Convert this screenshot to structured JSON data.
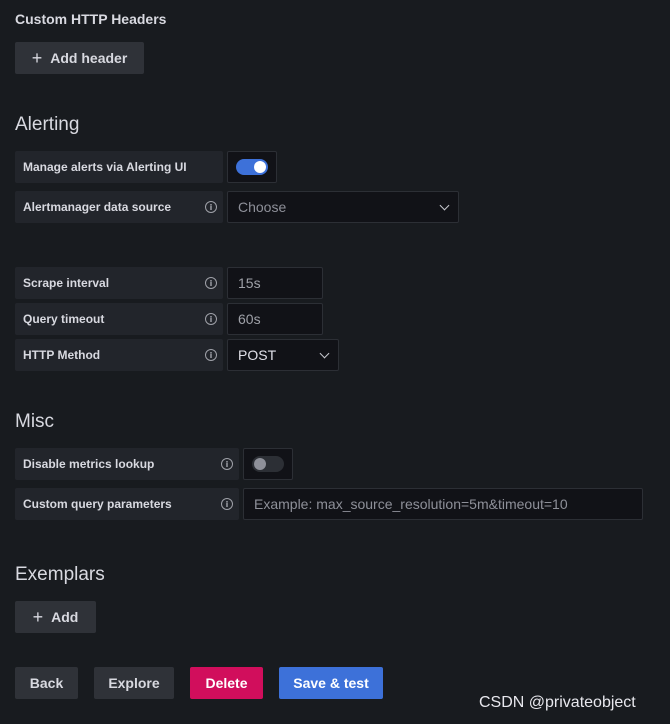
{
  "headers_section": {
    "title": "Custom HTTP Headers",
    "add_button": "Add header"
  },
  "alerting": {
    "title": "Alerting",
    "manage_alerts_label": "Manage alerts via Alerting UI",
    "manage_alerts_enabled": true,
    "alertmanager_label": "Alertmanager data source",
    "alertmanager_placeholder": "Choose"
  },
  "query": {
    "scrape_interval_label": "Scrape interval",
    "scrape_interval_placeholder": "15s",
    "query_timeout_label": "Query timeout",
    "query_timeout_placeholder": "60s",
    "http_method_label": "HTTP Method",
    "http_method_value": "POST"
  },
  "misc": {
    "title": "Misc",
    "disable_metrics_label": "Disable metrics lookup",
    "disable_metrics_enabled": false,
    "custom_params_label": "Custom query parameters",
    "custom_params_placeholder": "Example: max_source_resolution=5m&timeout=10"
  },
  "exemplars": {
    "title": "Exemplars",
    "add_button": "Add"
  },
  "actions": {
    "back": "Back",
    "explore": "Explore",
    "delete": "Delete",
    "save_test": "Save & test"
  },
  "watermark": "CSDN @privateobject",
  "icons": {
    "info": "info-circle-icon",
    "plus": "plus-icon",
    "chevron": "chevron-down-icon"
  },
  "colors": {
    "background": "#181b1f",
    "primary": "#3d71d9",
    "danger": "#d10e5c"
  }
}
